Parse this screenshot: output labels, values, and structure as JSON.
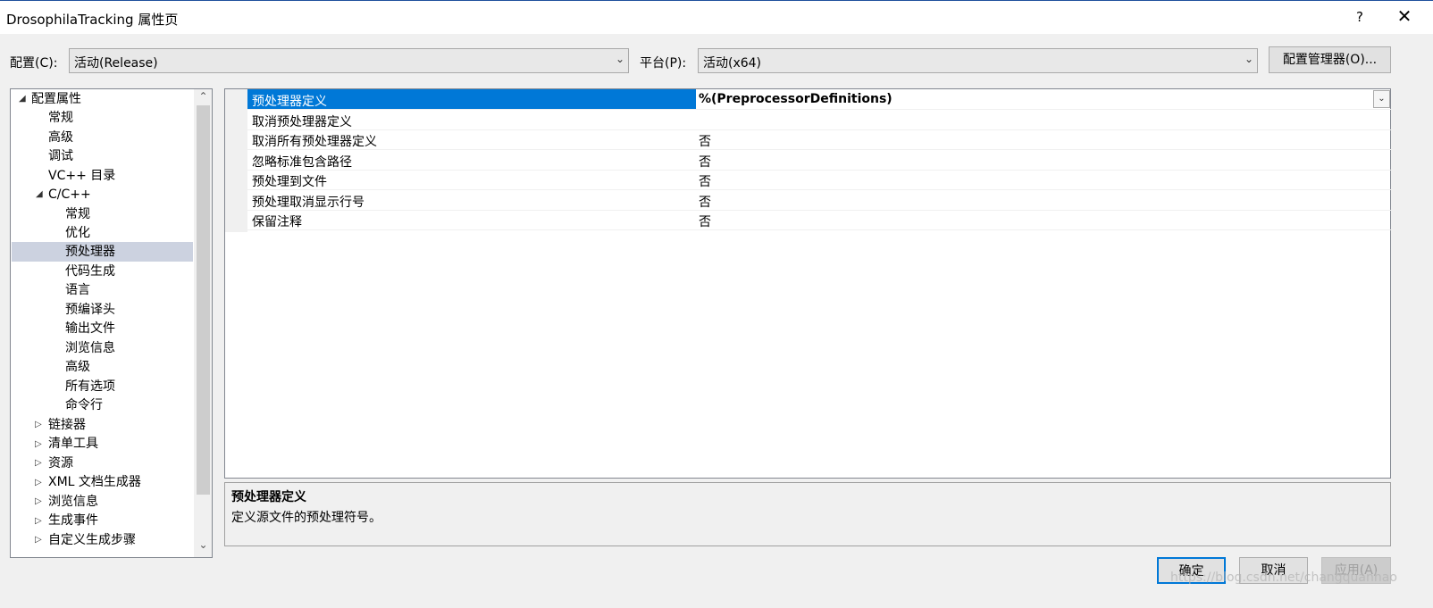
{
  "window": {
    "title": "DrosophilaTracking 属性页",
    "help_label": "?",
    "close_label": "✕"
  },
  "config": {
    "config_label": "配置(C):",
    "config_value": "活动(Release)",
    "platform_label": "平台(P):",
    "platform_value": "活动(x64)",
    "manager_button": "配置管理器(O)..."
  },
  "tree": {
    "items": [
      {
        "label": "配置属性"
      },
      {
        "label": "常规"
      },
      {
        "label": "高级"
      },
      {
        "label": "调试"
      },
      {
        "label": "VC++ 目录"
      },
      {
        "label": "C/C++"
      },
      {
        "label": "常规"
      },
      {
        "label": "优化"
      },
      {
        "label": "预处理器"
      },
      {
        "label": "代码生成"
      },
      {
        "label": "语言"
      },
      {
        "label": "预编译头"
      },
      {
        "label": "输出文件"
      },
      {
        "label": "浏览信息"
      },
      {
        "label": "高级"
      },
      {
        "label": "所有选项"
      },
      {
        "label": "命令行"
      },
      {
        "label": "链接器"
      },
      {
        "label": "清单工具"
      },
      {
        "label": "资源"
      },
      {
        "label": "XML 文档生成器"
      },
      {
        "label": "浏览信息"
      },
      {
        "label": "生成事件"
      },
      {
        "label": "自定义生成步骤"
      }
    ],
    "selected_label": "预处理器"
  },
  "properties": [
    {
      "name": "预处理器定义",
      "value": "%(PreprocessorDefinitions)"
    },
    {
      "name": "取消预处理器定义",
      "value": ""
    },
    {
      "name": "取消所有预处理器定义",
      "value": "否"
    },
    {
      "name": "忽略标准包含路径",
      "value": "否"
    },
    {
      "name": "预处理到文件",
      "value": "否"
    },
    {
      "name": "预处理取消显示行号",
      "value": "否"
    },
    {
      "name": "保留注释",
      "value": "否"
    }
  ],
  "description": {
    "title": "预处理器定义",
    "text": "定义源文件的预处理符号。"
  },
  "buttons": {
    "ok": "确定",
    "cancel": "取消",
    "apply": "应用(A)"
  },
  "watermark": "https://blog.csdn.net/changquanhao",
  "colors": {
    "selection": "#0078d7",
    "tree_selection": "#ccd2e0"
  }
}
